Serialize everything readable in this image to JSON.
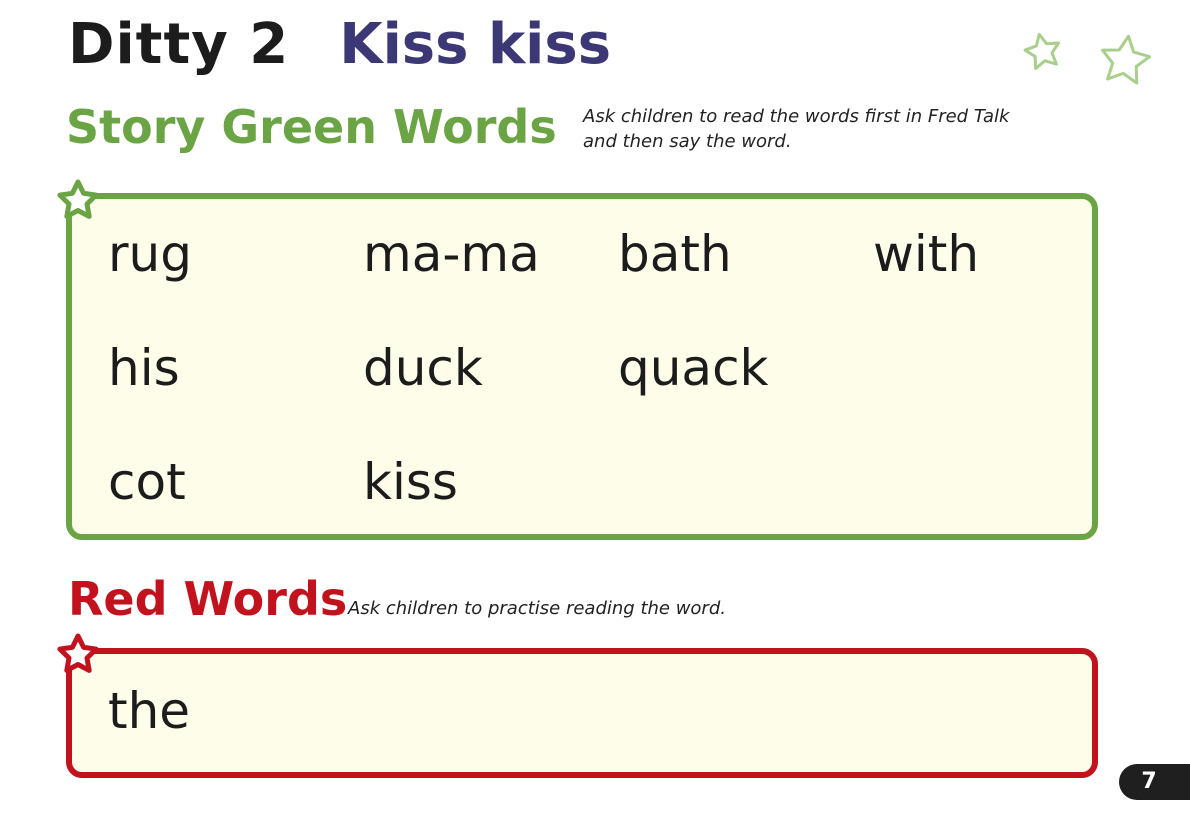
{
  "header": {
    "ditty_label": "Ditty 2",
    "story_title": "Kiss kiss"
  },
  "green_words": {
    "heading": "Story Green Words",
    "note_line1": "Ask children to read the words first in Fred Talk",
    "note_line2": "and then say the word.",
    "words": [
      "rug",
      "ma-ma",
      "bath",
      "with",
      "his",
      "duck",
      "quack",
      "cot",
      "kiss"
    ]
  },
  "red_words": {
    "heading": "Red Words",
    "note": "Ask children to practise reading the word.",
    "words": [
      "the"
    ]
  },
  "page_number": "7",
  "colors": {
    "green": "#6aa444",
    "red": "#c2121e",
    "purple": "#3c3876",
    "box_fill": "#fefde9",
    "light_green_star": "#a9cf8c"
  },
  "icons": [
    "star-icon"
  ]
}
